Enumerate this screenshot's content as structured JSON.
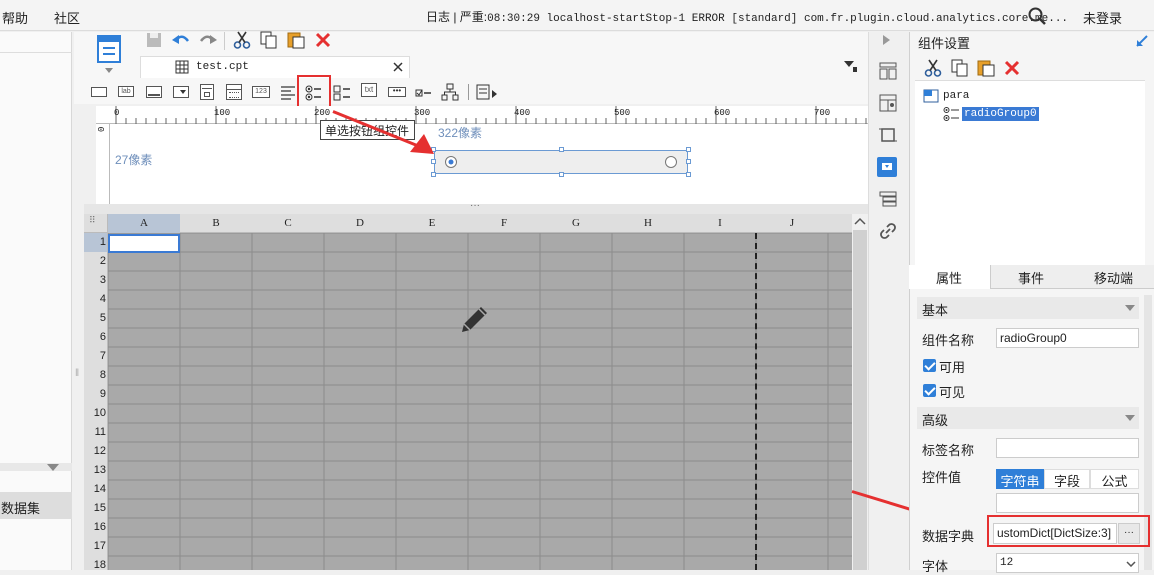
{
  "menu": {
    "help": "帮助",
    "community": "社区"
  },
  "log": {
    "prefix": "日志 | 严重:",
    "message": "08:30:29 localhost-startStop-1 ERROR [standard] com.fr.plugin.cloud.analytics.core.me..."
  },
  "login": "未登录",
  "left_panel": {
    "dataset_label": "数据集"
  },
  "tab": {
    "filename": "test.cpt"
  },
  "toolbar": {
    "tooltip": "单选按钮组控件"
  },
  "ruler": {
    "ticks": [
      "0",
      "100",
      "200",
      "300",
      "400",
      "500",
      "600",
      "700"
    ]
  },
  "design": {
    "width_label": "322像素",
    "height_label": "27像素"
  },
  "sheet": {
    "columns": [
      "A",
      "B",
      "C",
      "D",
      "E",
      "F",
      "G",
      "H",
      "I",
      "J"
    ],
    "rows": [
      "1",
      "2",
      "3",
      "4",
      "5",
      "6",
      "7",
      "8",
      "9",
      "10",
      "11",
      "12",
      "13",
      "14",
      "15",
      "16",
      "17",
      "18"
    ]
  },
  "right_panel": {
    "title": "组件设置",
    "tree_root": "para",
    "tree_child": "radioGroup0",
    "tabs": [
      "属性",
      "事件",
      "移动端"
    ],
    "section_basic": "基本",
    "name_label": "组件名称",
    "name_value": "radioGroup0",
    "enabled_label": "可用",
    "visible_label": "可见",
    "section_advanced": "高级",
    "tag_label": "标签名称",
    "tag_value": "",
    "control_value_label": "控件值",
    "control_value_options": [
      "字符串",
      "字段",
      "公式"
    ],
    "dict_label": "数据字典",
    "dict_value": "ustomDict[DictSize:3]",
    "dict_button": "···",
    "font_label": "字体",
    "font_value": "12"
  },
  "colors": {
    "accent": "#2f7fd8",
    "highlight": "#e53030",
    "selection": "#3a7ad4"
  }
}
